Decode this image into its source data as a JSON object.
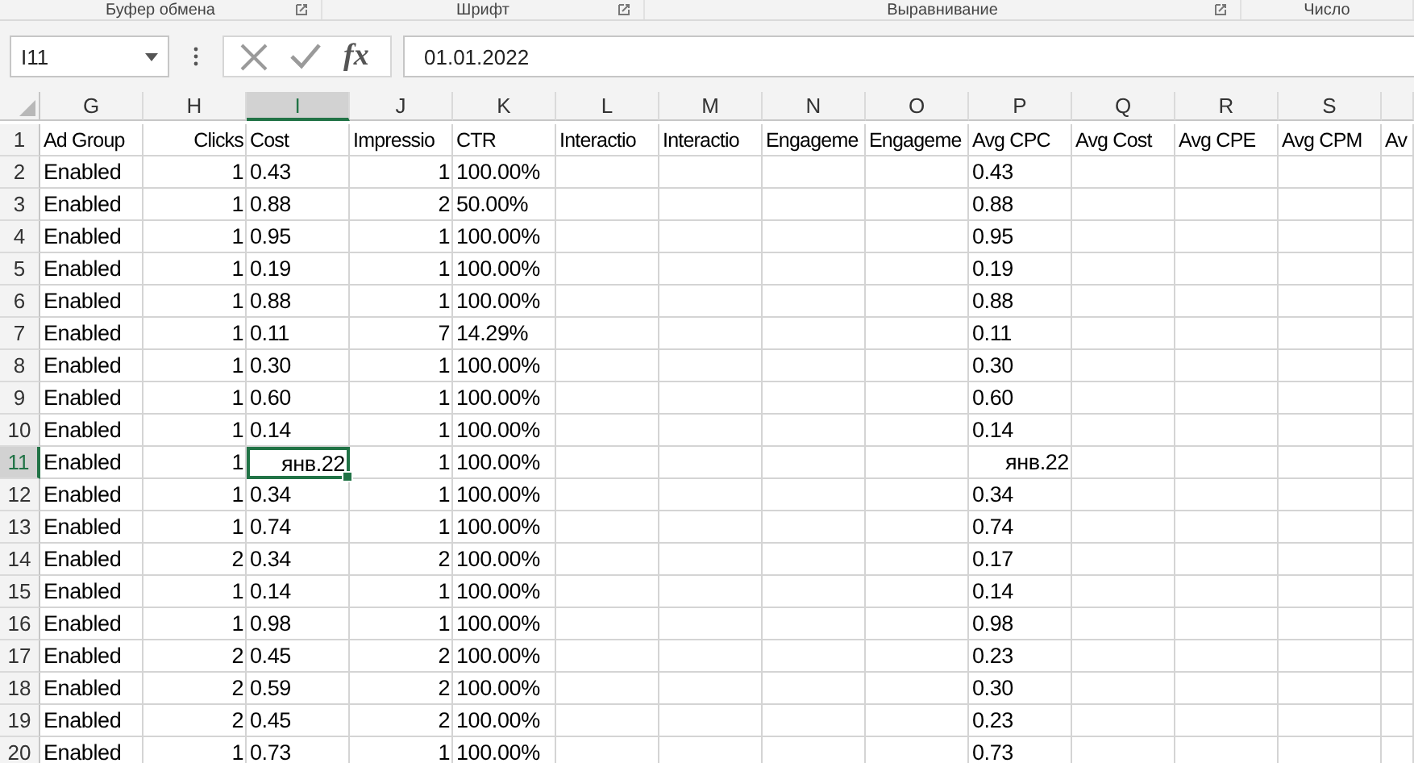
{
  "ribbon_groups": [
    {
      "label": "Буфер обмена"
    },
    {
      "label": "Шрифт"
    },
    {
      "label": "Выравнивание"
    },
    {
      "label": "Число"
    }
  ],
  "formula_bar": {
    "name_box": "I11",
    "fx": "fx",
    "value": "01.01.2022"
  },
  "columns": [
    {
      "letter": "G",
      "selected": false,
      "kind": "text"
    },
    {
      "letter": "H",
      "selected": false,
      "kind": "number"
    },
    {
      "letter": "I",
      "selected": true,
      "kind": "text"
    },
    {
      "letter": "J",
      "selected": false,
      "kind": "number"
    },
    {
      "letter": "K",
      "selected": false,
      "kind": "text"
    },
    {
      "letter": "L",
      "selected": false,
      "kind": "text"
    },
    {
      "letter": "M",
      "selected": false,
      "kind": "text"
    },
    {
      "letter": "N",
      "selected": false,
      "kind": "text"
    },
    {
      "letter": "O",
      "selected": false,
      "kind": "text"
    },
    {
      "letter": "P",
      "selected": false,
      "kind": "text"
    },
    {
      "letter": "Q",
      "selected": false,
      "kind": "text"
    },
    {
      "letter": "R",
      "selected": false,
      "kind": "text"
    },
    {
      "letter": "S",
      "selected": false,
      "kind": "text"
    },
    {
      "selected": false,
      "kind": "text"
    }
  ],
  "rows": [
    {
      "number": "1",
      "selected": false,
      "cells": [
        "Ad Group",
        "Clicks",
        "Cost",
        {
          "text": "Impressio",
          "kind": "text"
        },
        "CTR",
        "Interactio",
        "Interactio",
        "Engageme",
        "Engageme",
        "Avg CPC",
        "Avg Cost",
        "Avg CPE",
        "Avg CPM",
        "Av"
      ]
    },
    {
      "number": "2",
      "selected": false,
      "cells": [
        "Enabled",
        "1",
        "0.43",
        "1",
        "100.00%",
        null,
        null,
        null,
        null,
        "0.43",
        null,
        null,
        null,
        null
      ]
    },
    {
      "number": "3",
      "selected": false,
      "cells": [
        "Enabled",
        "1",
        "0.88",
        "2",
        "50.00%",
        null,
        null,
        null,
        null,
        "0.88",
        null,
        null,
        null,
        null
      ]
    },
    {
      "number": "4",
      "selected": false,
      "cells": [
        "Enabled",
        "1",
        "0.95",
        "1",
        "100.00%",
        null,
        null,
        null,
        null,
        "0.95",
        null,
        null,
        null,
        null
      ]
    },
    {
      "number": "5",
      "selected": false,
      "cells": [
        "Enabled",
        "1",
        "0.19",
        "1",
        "100.00%",
        null,
        null,
        null,
        null,
        "0.19",
        null,
        null,
        null,
        null
      ]
    },
    {
      "number": "6",
      "selected": false,
      "cells": [
        "Enabled",
        "1",
        "0.88",
        "1",
        "100.00%",
        null,
        null,
        null,
        null,
        "0.88",
        null,
        null,
        null,
        null
      ]
    },
    {
      "number": "7",
      "selected": false,
      "cells": [
        "Enabled",
        "1",
        "0.11",
        "7",
        "14.29%",
        null,
        null,
        null,
        null,
        "0.11",
        null,
        null,
        null,
        null
      ]
    },
    {
      "number": "8",
      "selected": false,
      "cells": [
        "Enabled",
        "1",
        "0.30",
        "1",
        "100.00%",
        null,
        null,
        null,
        null,
        "0.30",
        null,
        null,
        null,
        null
      ]
    },
    {
      "number": "9",
      "selected": false,
      "cells": [
        "Enabled",
        "1",
        "0.60",
        "1",
        "100.00%",
        null,
        null,
        null,
        null,
        "0.60",
        null,
        null,
        null,
        null
      ]
    },
    {
      "number": "10",
      "selected": false,
      "cells": [
        "Enabled",
        "1",
        "0.14",
        "1",
        "100.00%",
        null,
        null,
        null,
        null,
        "0.14",
        null,
        null,
        null,
        null
      ]
    },
    {
      "number": "11",
      "selected": true,
      "cells": [
        "Enabled",
        "1",
        {
          "text": "янв.22",
          "kind": "date"
        },
        "1",
        "100.00%",
        null,
        null,
        null,
        null,
        {
          "text": "янв.22",
          "kind": "date"
        },
        null,
        null,
        null,
        null
      ]
    },
    {
      "number": "12",
      "selected": false,
      "cells": [
        "Enabled",
        "1",
        "0.34",
        "1",
        "100.00%",
        null,
        null,
        null,
        null,
        "0.34",
        null,
        null,
        null,
        null
      ]
    },
    {
      "number": "13",
      "selected": false,
      "cells": [
        "Enabled",
        "1",
        "0.74",
        "1",
        "100.00%",
        null,
        null,
        null,
        null,
        "0.74",
        null,
        null,
        null,
        null
      ]
    },
    {
      "number": "14",
      "selected": false,
      "cells": [
        "Enabled",
        "2",
        "0.34",
        "2",
        "100.00%",
        null,
        null,
        null,
        null,
        "0.17",
        null,
        null,
        null,
        null
      ]
    },
    {
      "number": "15",
      "selected": false,
      "cells": [
        "Enabled",
        "1",
        "0.14",
        "1",
        "100.00%",
        null,
        null,
        null,
        null,
        "0.14",
        null,
        null,
        null,
        null
      ]
    },
    {
      "number": "16",
      "selected": false,
      "cells": [
        "Enabled",
        "1",
        "0.98",
        "1",
        "100.00%",
        null,
        null,
        null,
        null,
        "0.98",
        null,
        null,
        null,
        null
      ]
    },
    {
      "number": "17",
      "selected": false,
      "cells": [
        "Enabled",
        "2",
        "0.45",
        "2",
        "100.00%",
        null,
        null,
        null,
        null,
        "0.23",
        null,
        null,
        null,
        null
      ]
    },
    {
      "number": "18",
      "selected": false,
      "cells": [
        "Enabled",
        "2",
        "0.59",
        "2",
        "100.00%",
        null,
        null,
        null,
        null,
        "0.30",
        null,
        null,
        null,
        null
      ]
    },
    {
      "number": "19",
      "selected": false,
      "cells": [
        "Enabled",
        "2",
        "0.45",
        "2",
        "100.00%",
        null,
        null,
        null,
        null,
        "0.23",
        null,
        null,
        null,
        null
      ]
    },
    {
      "number": "20",
      "selected": false,
      "cells": [
        "Enabled",
        "1",
        "0.73",
        "1",
        "100.00%",
        null,
        null,
        null,
        null,
        "0.73",
        null,
        null,
        null,
        null
      ]
    }
  ]
}
